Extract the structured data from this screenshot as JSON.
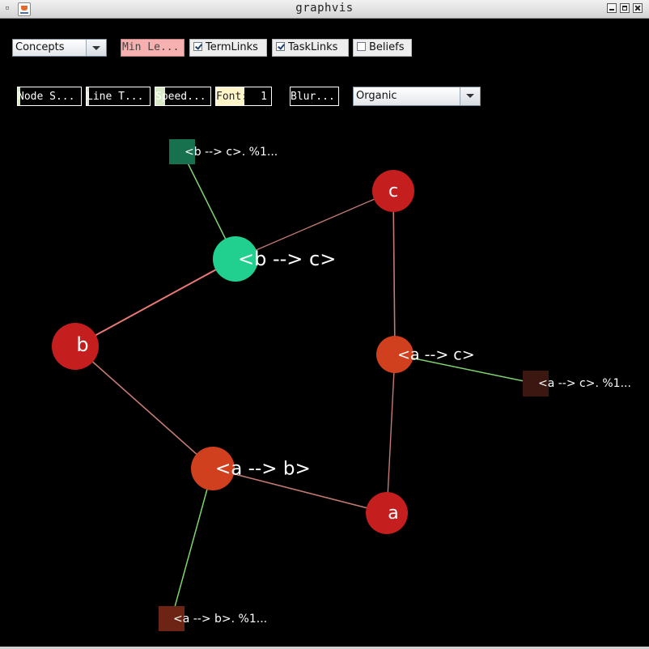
{
  "window": {
    "title": "graphvis",
    "sys_icon": "window-menu-icon",
    "app_icon": "java-icon"
  },
  "toolbar1": {
    "view_select": {
      "value": "Concepts"
    },
    "min_level_button": "Min Le...",
    "termlinks": {
      "label": "TermLinks",
      "checked": true
    },
    "tasklinks": {
      "label": "TaskLinks",
      "checked": true
    },
    "beliefs": {
      "label": "Beliefs",
      "checked": false
    }
  },
  "toolbar2": {
    "node_size": {
      "label": "Node S..."
    },
    "line_thickness": {
      "label": "Line T..."
    },
    "speed": {
      "label": "Speed..."
    },
    "font": {
      "label": "Font:",
      "value": "1"
    },
    "blur": {
      "label": "Blur..."
    },
    "layout_select": {
      "value": "Organic"
    }
  },
  "graph": {
    "concepts": [
      {
        "id": "b_to_c",
        "label": "<b --> c>",
        "color": "#21d08f"
      },
      {
        "id": "c",
        "label": "c",
        "color": "#c41e1e"
      },
      {
        "id": "b",
        "label": "b",
        "color": "#c41e1e"
      },
      {
        "id": "a_to_c",
        "label": "<a --> c>",
        "color": "#d0401f"
      },
      {
        "id": "a_to_b",
        "label": "<a --> b>",
        "color": "#d0401f"
      },
      {
        "id": "a",
        "label": "a",
        "color": "#c41e1e"
      }
    ],
    "tasks": [
      {
        "id": "task_b_to_c",
        "label": "<b --> c>. %1...",
        "color": "#17704e"
      },
      {
        "id": "task_a_to_c",
        "label": "<a --> c>. %1...",
        "color": "#3c1712"
      },
      {
        "id": "task_a_to_b",
        "label": "<a --> b>. %1...",
        "color": "#6e2415"
      }
    ],
    "edge_colors": {
      "termlink": "#c47b74",
      "termlink_strong": "#e87a74",
      "tasklink": "#7fd66f"
    }
  }
}
